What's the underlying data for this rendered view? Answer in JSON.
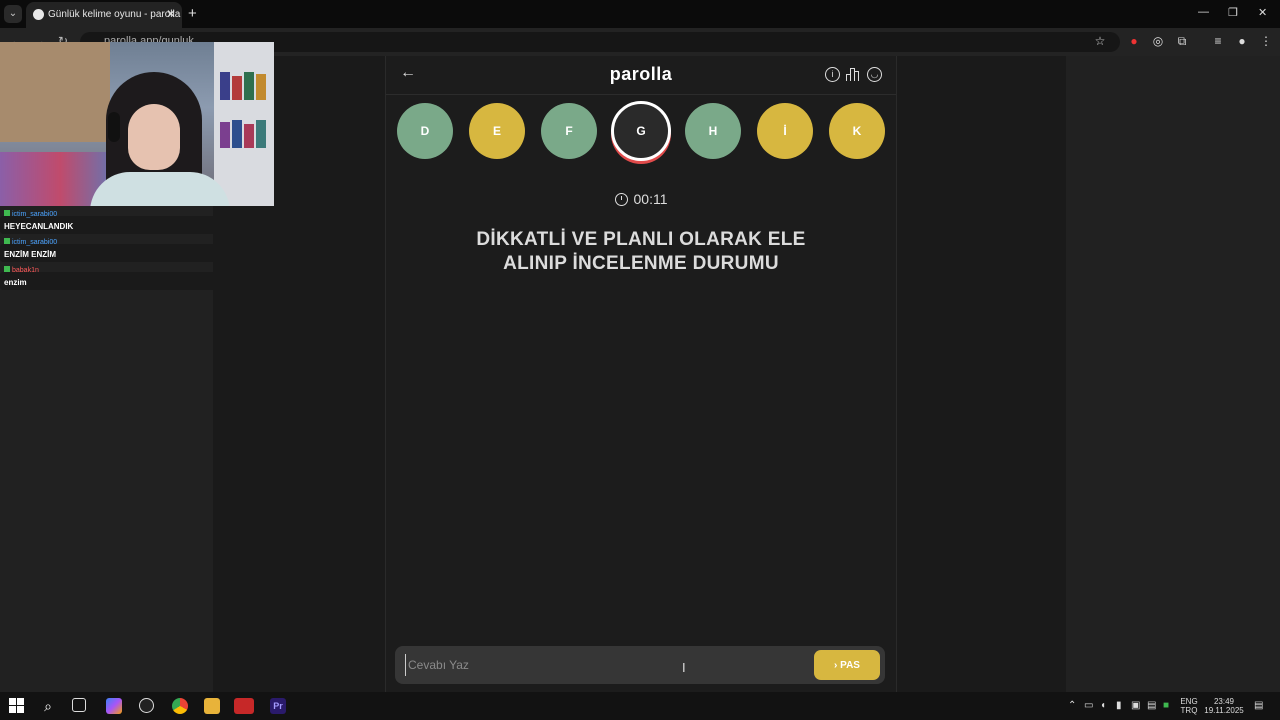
{
  "browser": {
    "tab_title": "Günlük kelime oyunu - parolla",
    "tab_close": "✕",
    "new_tab": "+",
    "url": "parolla.app/gunluk",
    "win_min": "—",
    "win_max": "❐",
    "win_close": "✕"
  },
  "game": {
    "logo": "parolla",
    "back_icon": "←",
    "info_icon": "i",
    "letters": [
      {
        "letter": "D",
        "state": "green"
      },
      {
        "letter": "E",
        "state": "yellow"
      },
      {
        "letter": "F",
        "state": "green"
      },
      {
        "letter": "G",
        "state": "active"
      },
      {
        "letter": "H",
        "state": "green"
      },
      {
        "letter": "İ",
        "state": "yellow"
      },
      {
        "letter": "K",
        "state": "yellow"
      }
    ],
    "timer": "00:11",
    "question": "DİKKATLİ VE PLANLI OLARAK ELE ALINIP İNCELENME DURUMU",
    "answer_placeholder": "Cevabı Yaz",
    "pass_label": "› PAS",
    "colors": {
      "green": "#7aa989",
      "yellow": "#d7b740",
      "active_ring": "#e04b4b"
    }
  },
  "chat": [
    {
      "user": "ictim_sarabi00",
      "text": "HEYECANLANDIK",
      "user_color": "blue"
    },
    {
      "user": "ictim_sarabi00",
      "text": "ENZİM ENZİM",
      "user_color": "blue"
    },
    {
      "user": "babak1n",
      "text": "enzim",
      "user_color": "red"
    }
  ],
  "taskbar": {
    "lang1": "ENG",
    "lang2": "TRQ",
    "time": "23:49",
    "date": "19.11.2025"
  }
}
